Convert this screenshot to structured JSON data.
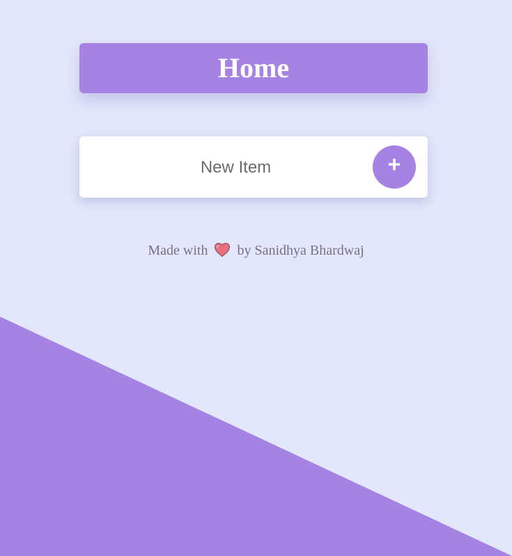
{
  "colors": {
    "background": "#e2e7fb",
    "accent": "#a683e3",
    "card": "#ffffff",
    "heart": "#e8707f"
  },
  "header": {
    "title": "Home"
  },
  "item_form": {
    "placeholder": "New Item",
    "value": "",
    "add_button_label": "+"
  },
  "footer": {
    "prefix": "Made with",
    "icon": "heart-icon",
    "suffix": "by Sanidhya Bhardwaj"
  }
}
